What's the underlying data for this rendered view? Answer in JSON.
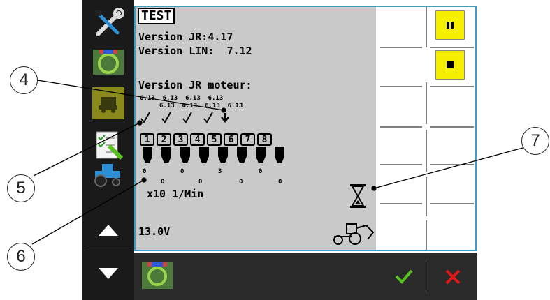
{
  "title": "TEST",
  "version_jr_label": "Version JR:",
  "version_jr_value": "4.17",
  "version_lin_label": "Version LIN:",
  "version_lin_value": "7.12",
  "version_motor_label": "Version JR moteur:",
  "motor_versions_row1": [
    "6.13",
    "6.13",
    "6.13",
    "6.13"
  ],
  "motor_versions_row2": [
    "6.13",
    "6.13",
    "6.13",
    "6.13"
  ],
  "sections": [
    "1",
    "2",
    "3",
    "4",
    "5",
    "6",
    "7",
    "8"
  ],
  "speeds_row1": [
    "0",
    "0",
    "3",
    "0"
  ],
  "speeds_row2": [
    "0",
    "0",
    "0",
    "0"
  ],
  "speed_unit": "x10 1/Min",
  "voltage": "13.0V",
  "callouts": [
    "4",
    "5",
    "6",
    "7"
  ],
  "colors": {
    "accent": "#3aa0c8",
    "yellow": "#f6f000",
    "ok": "#5ac21e",
    "cancel": "#e01818"
  },
  "icons": [
    "wrench-screwdriver-icon",
    "steering-wheel-icon",
    "seeder-icon",
    "checklist-icon",
    "tractor-icon",
    "arrow-up-icon",
    "arrow-down-icon",
    "pause-icon",
    "stop-icon",
    "hourglass-icon",
    "loader-icon",
    "check-icon",
    "close-icon"
  ]
}
